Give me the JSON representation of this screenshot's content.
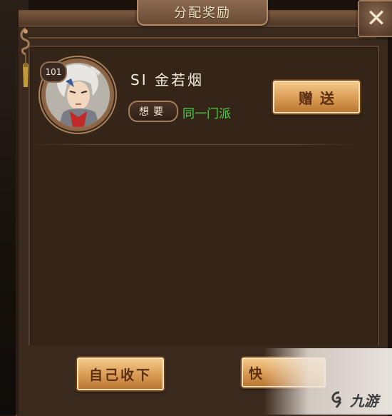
{
  "dialog": {
    "title": "分配奖励",
    "close_icon": "close-x-icon"
  },
  "player": {
    "level": "101",
    "name": "SI 金若烟",
    "want_tag": "想要",
    "relation": "同一门派",
    "gift_button": "赠送"
  },
  "footer": {
    "keep_button": "自己收下",
    "quick_button": "快"
  },
  "watermark": {
    "text": "九游",
    "icon": "swirl-logo-icon"
  },
  "colors": {
    "relation_text": "#4fce4a",
    "button_gold": "#d99a52",
    "panel_brown": "#3a2a1e"
  }
}
